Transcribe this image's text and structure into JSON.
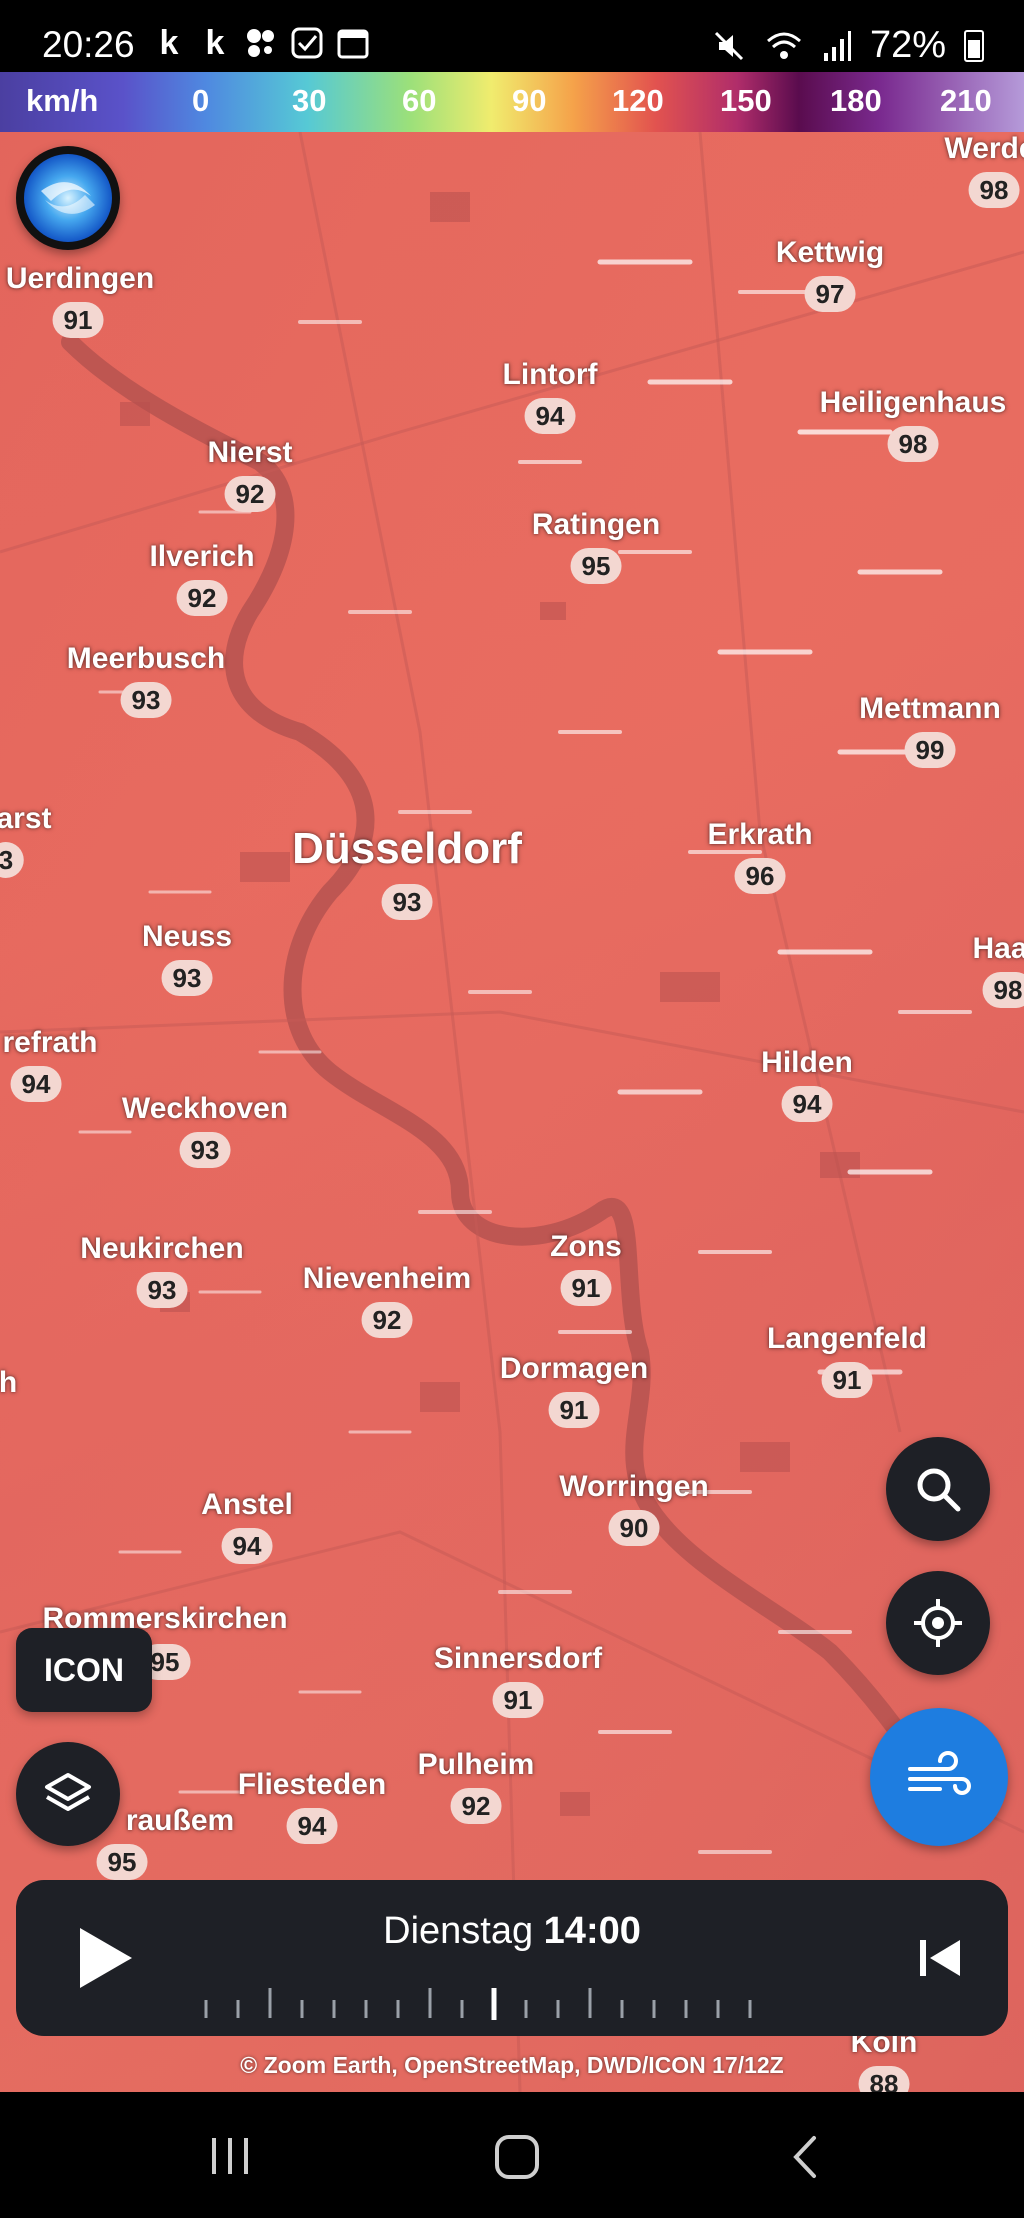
{
  "status_bar": {
    "time": "20:26",
    "app_icons": [
      "k",
      "k"
    ],
    "battery": "72%"
  },
  "legend": {
    "unit": "km/h",
    "stops": [
      "0",
      "30",
      "60",
      "90",
      "120",
      "150",
      "180",
      "210"
    ]
  },
  "cities": [
    {
      "name": "Werde",
      "value": "98"
    },
    {
      "name": "Uerdingen",
      "value": "91"
    },
    {
      "name": "Kettwig",
      "value": "97"
    },
    {
      "name": "Lintorf",
      "value": "94"
    },
    {
      "name": "Heiligenhaus",
      "value": "98"
    },
    {
      "name": "Nierst",
      "value": "92"
    },
    {
      "name": "Ratingen",
      "value": "95"
    },
    {
      "name": "Ilverich",
      "value": "92"
    },
    {
      "name": "Meerbusch",
      "value": "93"
    },
    {
      "name": "Mettmann",
      "value": "99"
    },
    {
      "name": "arst",
      "value": "3"
    },
    {
      "name": "Düsseldorf",
      "value": "93"
    },
    {
      "name": "Erkrath",
      "value": "96"
    },
    {
      "name": "Neuss",
      "value": "93"
    },
    {
      "name": "Haa",
      "value": "98"
    },
    {
      "name": "refrath",
      "value": "94"
    },
    {
      "name": "Hilden",
      "value": "94"
    },
    {
      "name": "Weckhoven",
      "value": "93"
    },
    {
      "name": "Zons",
      "value": "91"
    },
    {
      "name": "Neukirchen",
      "value": "93"
    },
    {
      "name": "Nievenheim",
      "value": "92"
    },
    {
      "name": "Langenfeld",
      "value": "91"
    },
    {
      "name": "Dormagen",
      "value": "91"
    },
    {
      "name": "h",
      "value": ""
    },
    {
      "name": "Worringen",
      "value": "90"
    },
    {
      "name": "Anstel",
      "value": "94"
    },
    {
      "name": "Rommerskirchen",
      "value": "95"
    },
    {
      "name": "Sinnersdorf",
      "value": "91"
    },
    {
      "name": "Pulheim",
      "value": "92"
    },
    {
      "name": "Fliesteden",
      "value": "94"
    },
    {
      "name": "raußem",
      "value": "95"
    },
    {
      "name": "Köln",
      "value": "88"
    }
  ],
  "model_button": "ICON",
  "timeline": {
    "day": "Dienstag",
    "time": "14:00"
  },
  "attribution": "© Zoom Earth, OpenStreetMap, DWD/ICON 17/12Z",
  "icons": {
    "logo": "zoom-earth-logo-icon",
    "search": "search-icon",
    "locate": "crosshair-icon",
    "wind": "wind-icon",
    "layers": "layers-icon",
    "play": "play-icon",
    "rewind": "skip-back-icon"
  },
  "colors": {
    "map_base": "#e6695e",
    "wind_button": "#1e7de0",
    "dark_button": "#1e2026",
    "label_pill": "#f3d7d1"
  }
}
